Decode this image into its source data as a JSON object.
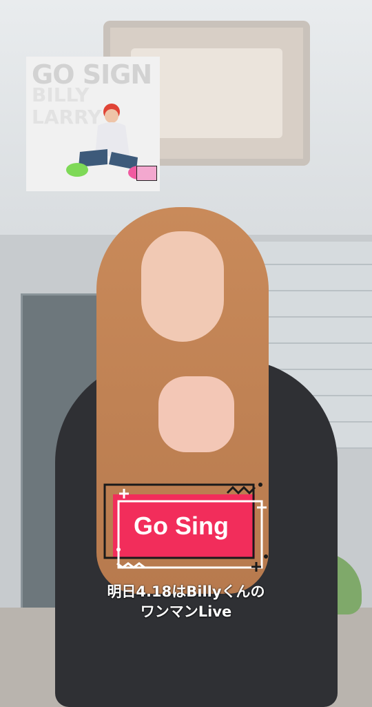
{
  "thumbnail": {
    "title": "GO SIGN",
    "background_text": "BILLY LARRY",
    "badge_color": "#f3a8cf"
  },
  "sticker": {
    "label": "Go Sing",
    "fill_color": "#f22d5b",
    "frame_color": "#1a1a1a"
  },
  "caption": {
    "line1": "明日4.18はBillyくんの",
    "line2": "ワンマンLive"
  }
}
